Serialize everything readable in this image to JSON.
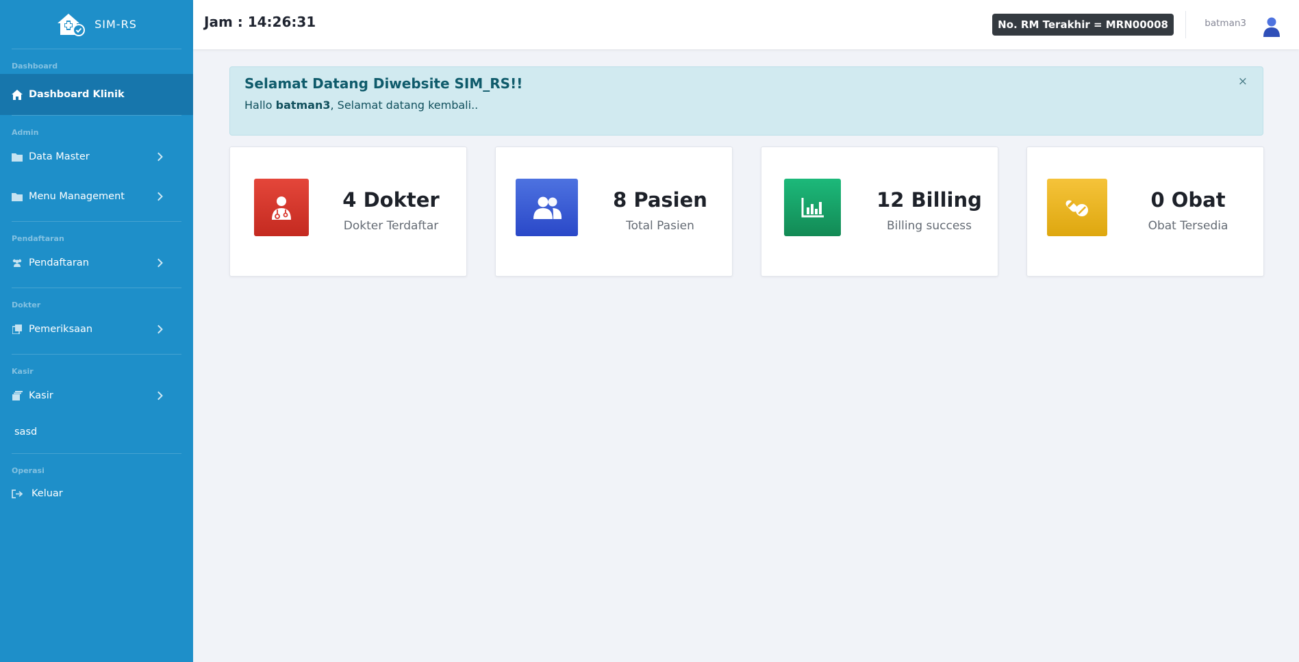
{
  "brand": {
    "name": "SIM-RS"
  },
  "sidebar": {
    "sections": [
      {
        "label": "Dashboard"
      },
      {
        "label": "Admin"
      },
      {
        "label": "Pendaftaran"
      },
      {
        "label": "Dokter"
      },
      {
        "label": "Kasir"
      },
      {
        "label": "Operasi"
      }
    ],
    "items": [
      {
        "label": "Dashboard Klinik",
        "icon": "home-icon"
      },
      {
        "label": "Data Master",
        "icon": "folder-icon"
      },
      {
        "label": "Menu Management",
        "icon": "folder-icon"
      },
      {
        "label": "Pendaftaran",
        "icon": "users-icon"
      },
      {
        "label": "Pemeriksaan",
        "icon": "copy-icon"
      },
      {
        "label": "Kasir",
        "icon": "stack-icon"
      },
      {
        "label": "sasd"
      },
      {
        "label": "Keluar",
        "icon": "sign-out-icon"
      }
    ]
  },
  "topbar": {
    "clock": "Jam : 14:26:31",
    "rm_badge": "No. RM Terakhir = MRN00008",
    "username": "batman3"
  },
  "alert": {
    "title": "Selamat Datang Diwebsite SIM_RS!!",
    "greeting": "Hallo ",
    "user": "batman3",
    "message": ", Selamat datang kembali..",
    "close": "×"
  },
  "cards": [
    {
      "value": "4 Dokter",
      "label": "Dokter Terdaftar",
      "color": "#d9362b",
      "icon": "doctor-icon"
    },
    {
      "value": "8 Pasien",
      "label": "Total Pasien",
      "color": "#3458d6",
      "icon": "users-icon"
    },
    {
      "value": "12 Billing",
      "label": "Billing success",
      "color": "#17995f",
      "icon": "chart-icon"
    },
    {
      "value": "0 Obat",
      "label": "Obat Tersedia",
      "color": "#eab01f",
      "icon": "pills-icon"
    }
  ]
}
